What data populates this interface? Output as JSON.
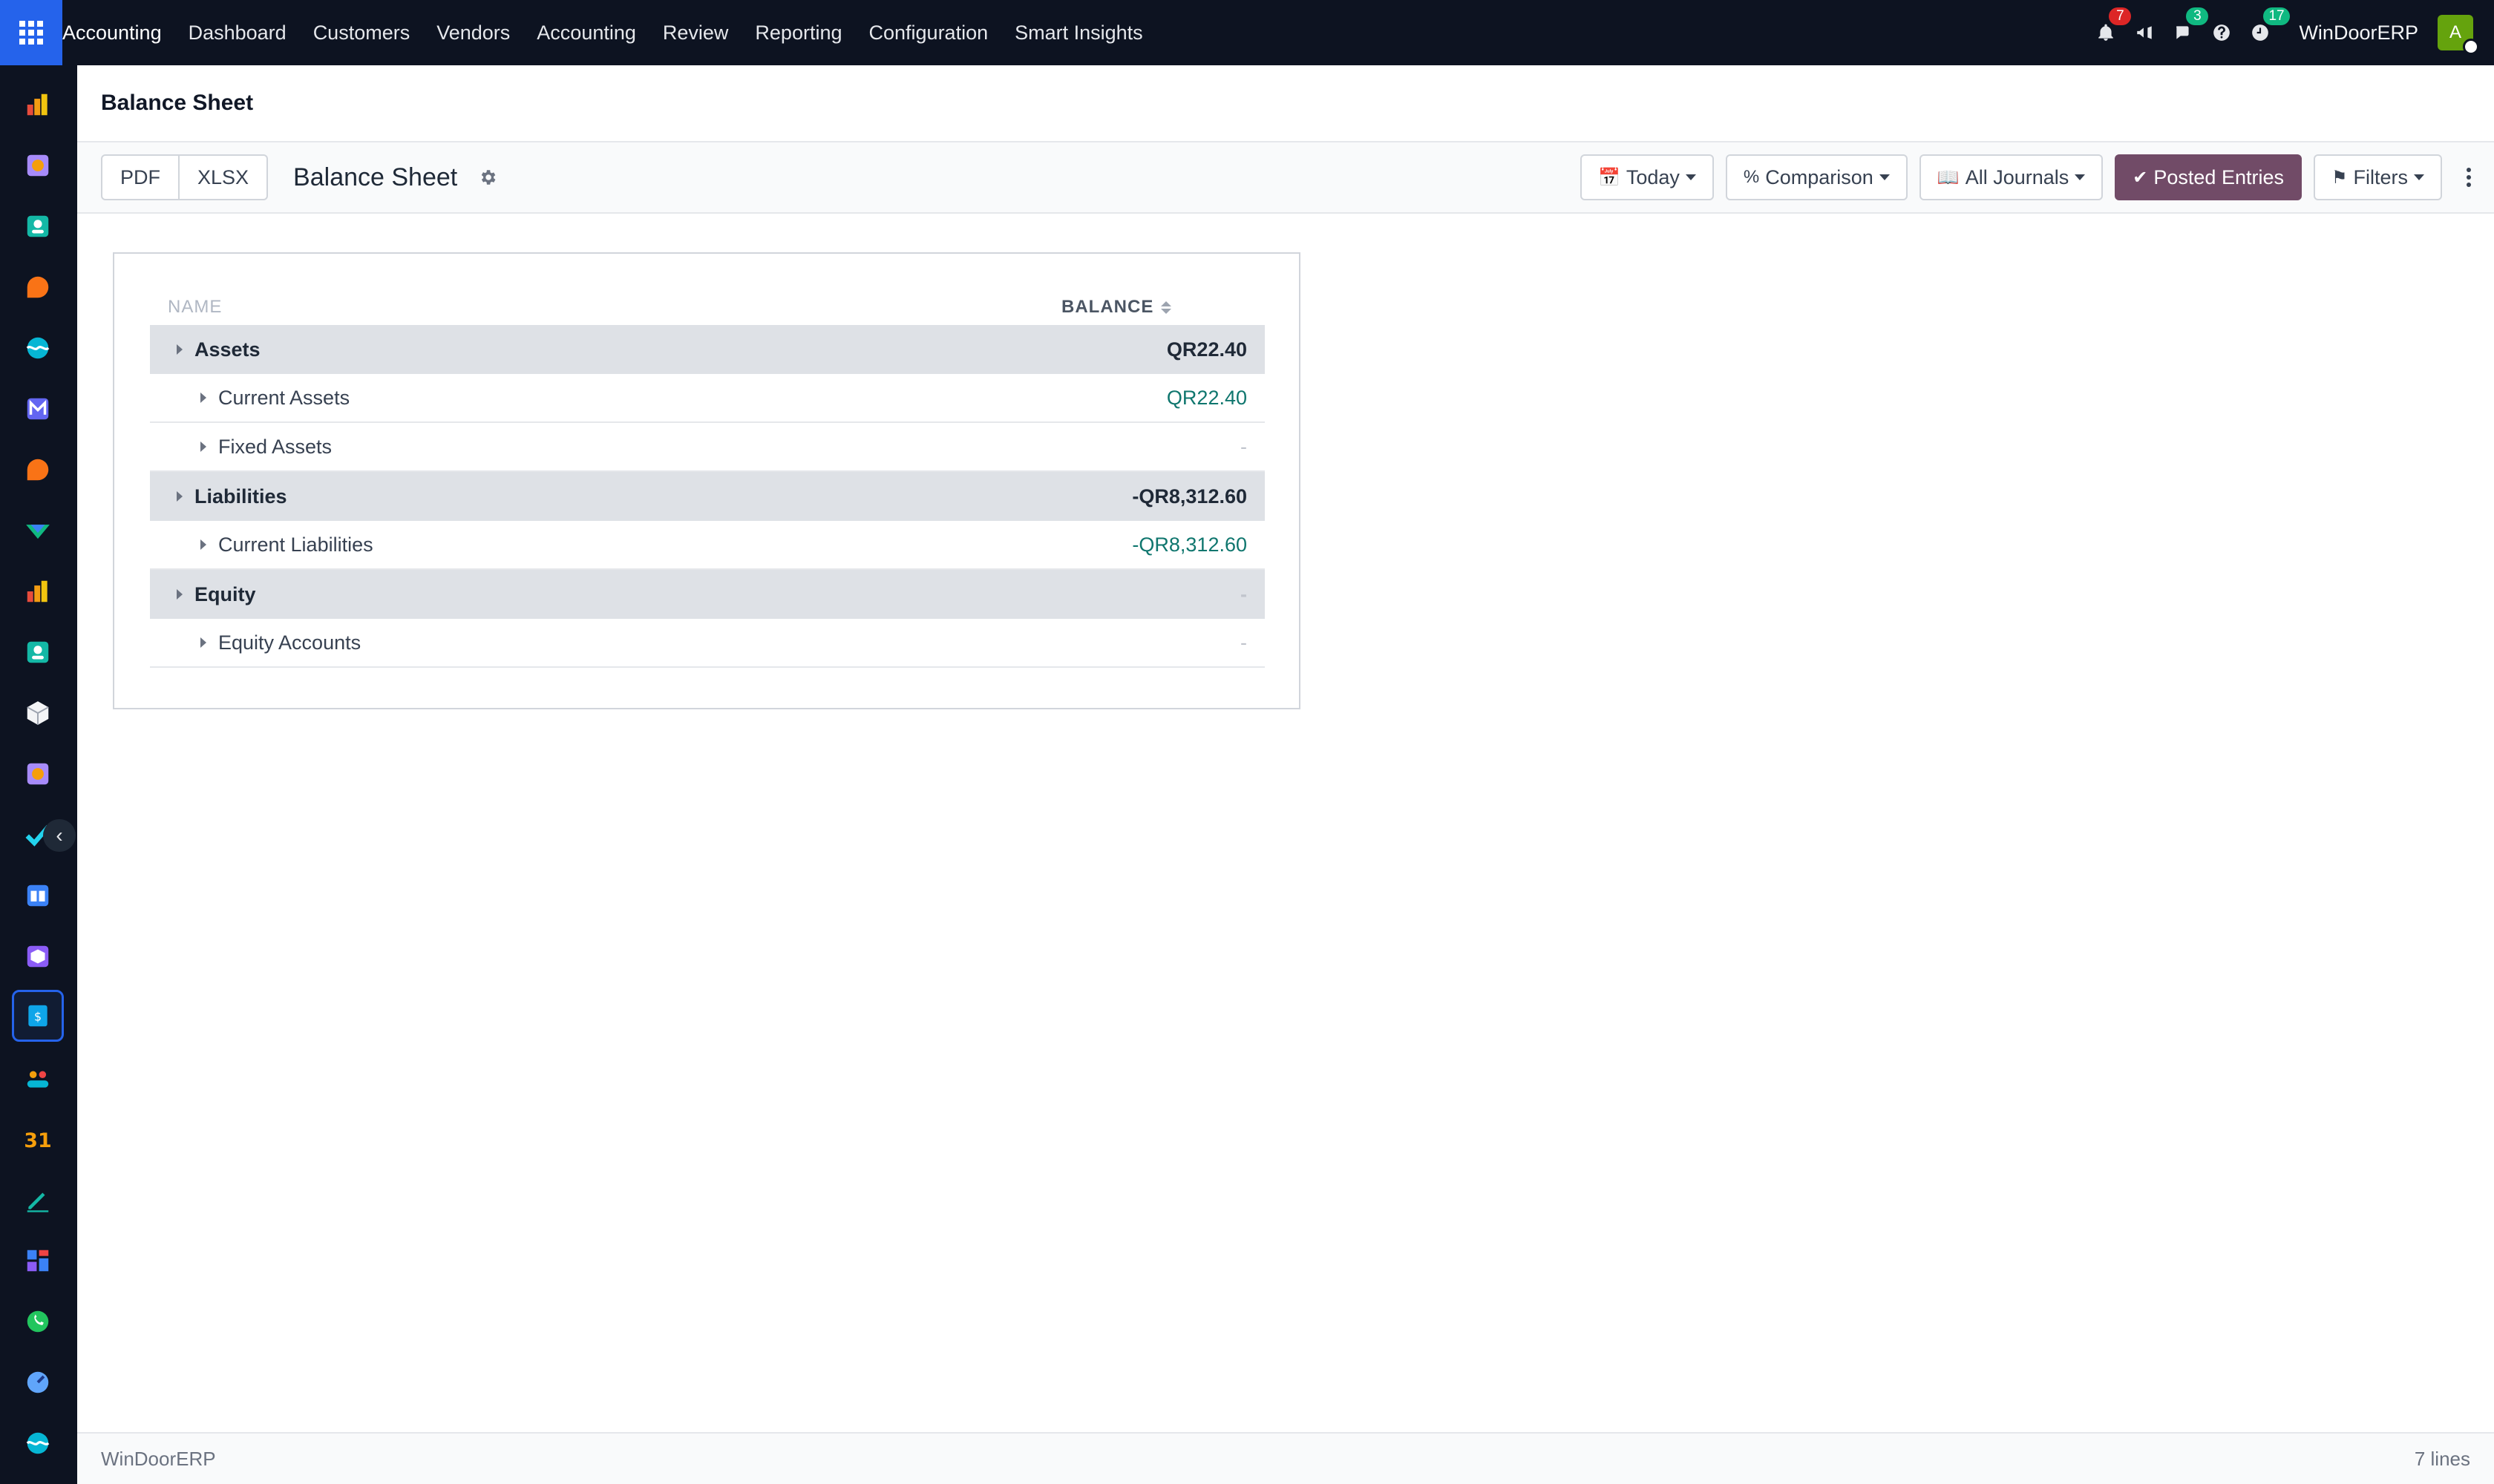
{
  "topnav": {
    "app_name": "Accounting",
    "menu": [
      "Dashboard",
      "Customers",
      "Vendors",
      "Accounting",
      "Review",
      "Reporting",
      "Configuration",
      "Smart Insights"
    ],
    "notifications_badge": "7",
    "messages_badge": "3",
    "activities_badge": "17",
    "company": "WinDoorERP",
    "user_initial": "A"
  },
  "page": {
    "title": "Balance Sheet"
  },
  "controls": {
    "pdf_label": "PDF",
    "xlsx_label": "XLSX",
    "report_title": "Balance Sheet",
    "date_filter": "Today",
    "comparison": "Comparison",
    "journals": "All Journals",
    "posted_entries": "Posted Entries",
    "filters": "Filters"
  },
  "report": {
    "columns": {
      "name": "NAME",
      "balance": "BALANCE"
    },
    "rows": [
      {
        "label": "Assets",
        "value": "QR22.40",
        "level": "section"
      },
      {
        "label": "Current Assets",
        "value": "QR22.40",
        "level": "sub"
      },
      {
        "label": "Fixed Assets",
        "value": "-",
        "level": "sub"
      },
      {
        "label": "Liabilities",
        "value": "-QR8,312.60",
        "level": "section"
      },
      {
        "label": "Current Liabilities",
        "value": "-QR8,312.60",
        "level": "sub"
      },
      {
        "label": "Equity",
        "value": "-",
        "level": "section"
      },
      {
        "label": "Equity Accounts",
        "value": "-",
        "level": "sub"
      }
    ]
  },
  "footer": {
    "company": "WinDoorERP",
    "line_count": "7 lines"
  },
  "colors": {
    "topbar": "#0d1321",
    "apps_button": "#2563eb",
    "primary_button": "#714b67",
    "positive_value": "#0f766e",
    "section_row": "#dee1e6"
  },
  "sidebar_icons": [
    "sales-icon",
    "puzzle-icon",
    "contacts-icon",
    "discuss-icon",
    "website-icon",
    "mail-icon",
    "chat-icon",
    "inventory-icon",
    "reporting-icon",
    "employees-icon",
    "package-icon",
    "plugin-icon",
    "check-icon",
    "knowledge-icon",
    "product-icon",
    "invoicing-icon",
    "team-icon",
    "calendar-icon",
    "sign-icon",
    "dashboard-icon",
    "whatsapp-icon",
    "time-icon",
    "website2-icon"
  ]
}
